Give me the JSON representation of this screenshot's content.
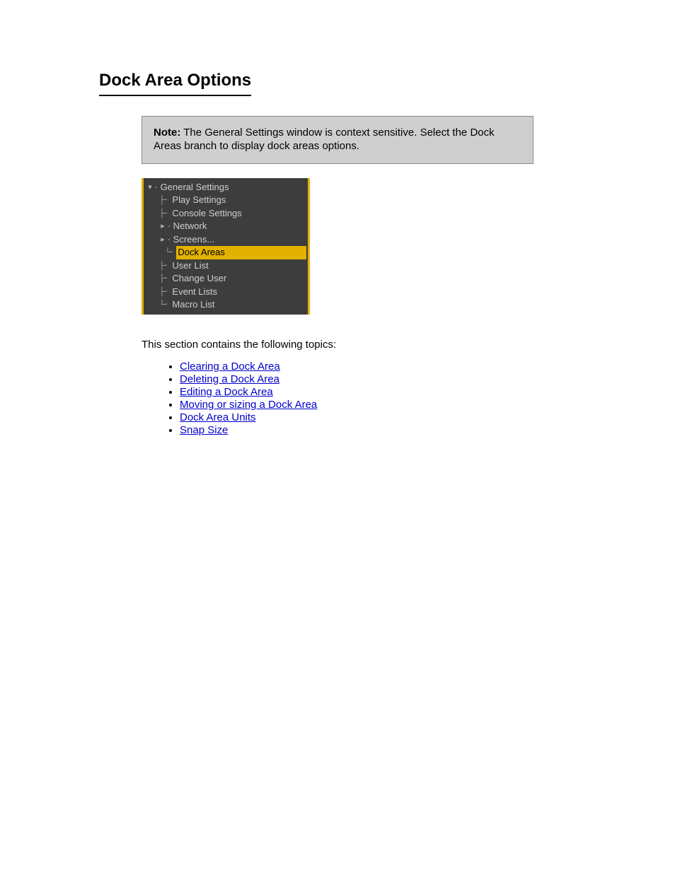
{
  "heading": "Dock Area Options",
  "note": {
    "prefix": "Note:",
    "body": "The General Settings window is context sensitive. Select the Dock Areas branch to display dock areas options."
  },
  "tree": {
    "root": "General Settings",
    "items": [
      {
        "label": "Play Settings",
        "depth": 2,
        "expander": ""
      },
      {
        "label": "Console Settings",
        "depth": 2,
        "expander": ""
      },
      {
        "label": "Network",
        "depth": 2,
        "expander": "closed"
      },
      {
        "label": "Screens...",
        "depth": 2,
        "expander": "closed"
      },
      {
        "label": "Dock Areas",
        "depth": 3,
        "expander": "",
        "selected": true
      },
      {
        "label": "User List",
        "depth": 2,
        "expander": ""
      },
      {
        "label": "Change User",
        "depth": 2,
        "expander": ""
      },
      {
        "label": "Event Lists",
        "depth": 2,
        "expander": ""
      },
      {
        "label": "Macro List",
        "depth": 2,
        "expander": ""
      }
    ]
  },
  "section_intro": "This section contains the following topics:",
  "links": [
    "Clearing a Dock Area",
    "Deleting a Dock Area",
    "Editing a Dock Area",
    "Moving or sizing a Dock Area",
    "Dock Area Units",
    "Snap Size"
  ]
}
